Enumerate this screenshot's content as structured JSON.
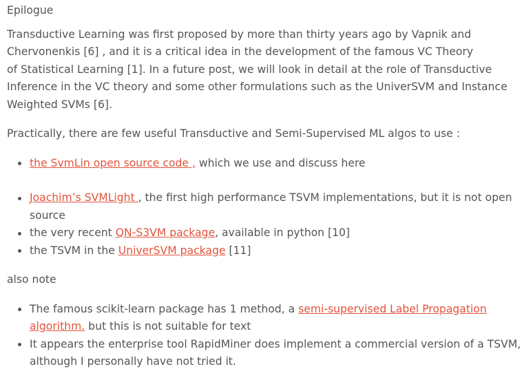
{
  "heading": "Epilogue",
  "para1": {
    "lines": [
      "Transductive Learning was first proposed by more than thirty years ago by Vapnik and",
      "Chervonenkis [6] , and it is a critical idea in the development of the famous VC Theory",
      "of Statistical Learning [1].  In a future post, we will look in detail at the role of Transductive",
      "Inference in the VC theory and some other formulations such as the UniverSVM and Instance",
      "Weighted SVMs [6]."
    ]
  },
  "para2": "Practically,  there are few useful Transductive and Semi-Supervised ML algos to use :",
  "list1": {
    "item1": {
      "link": "the SvmLin open source code ,",
      "text": " which we use and discuss here"
    }
  },
  "list2": {
    "item1": {
      "link": "Joachim’s SVMLight ",
      "text_line1": ", the first high performance TSVM implementations, but it is not open",
      "text_line2": "source"
    },
    "item2": {
      "prefix": "the very recent ",
      "link": "QN-S3VM package",
      "suffix": ", available in python [10]"
    },
    "item3": {
      "prefix": "the TSVM in the ",
      "link": "UniverSVM package",
      "suffix": " [11]"
    }
  },
  "para3": "also note",
  "list3": {
    "item1": {
      "prefix": "The famous scikit-learn package has 1 method, a ",
      "link_line1": "semi-supervised Label Propagation",
      "link_line2": "algorithm.",
      "suffix": " but this is not suitable for text"
    },
    "item2": {
      "line1": "It appears the enterprise tool RapidMiner does implement a commercial version of a TSVM,",
      "line2": "although I personally have not tried it."
    }
  },
  "colors": {
    "text": "#555555",
    "link": "#e2543c",
    "background": "#ffffff"
  }
}
